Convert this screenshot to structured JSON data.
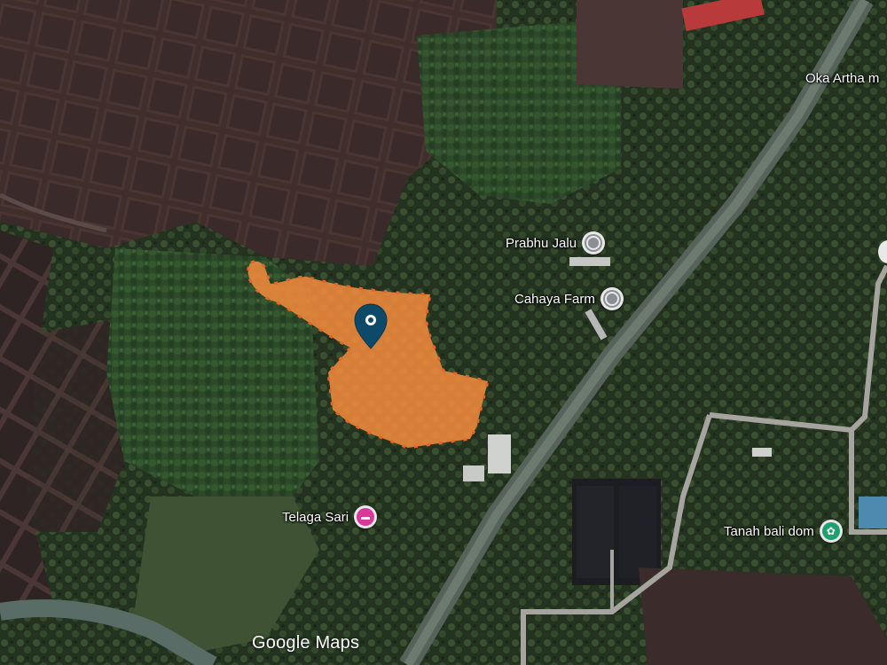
{
  "map": {
    "logo_text": "Google Maps",
    "selected_area_color": "#f08a3c",
    "selected_pin_color": "#0d4a6a",
    "places": [
      {
        "name": "Prabhu Jalu",
        "icon": "place-pin-icon"
      },
      {
        "name": "Cahaya Farm",
        "icon": "place-pin-icon"
      },
      {
        "name": "Telaga Sari",
        "icon": "hotel-bed-icon"
      },
      {
        "name": "Tanah bali dom",
        "icon": "flower-icon"
      },
      {
        "name": "Oka Artha m",
        "icon": ""
      }
    ]
  }
}
